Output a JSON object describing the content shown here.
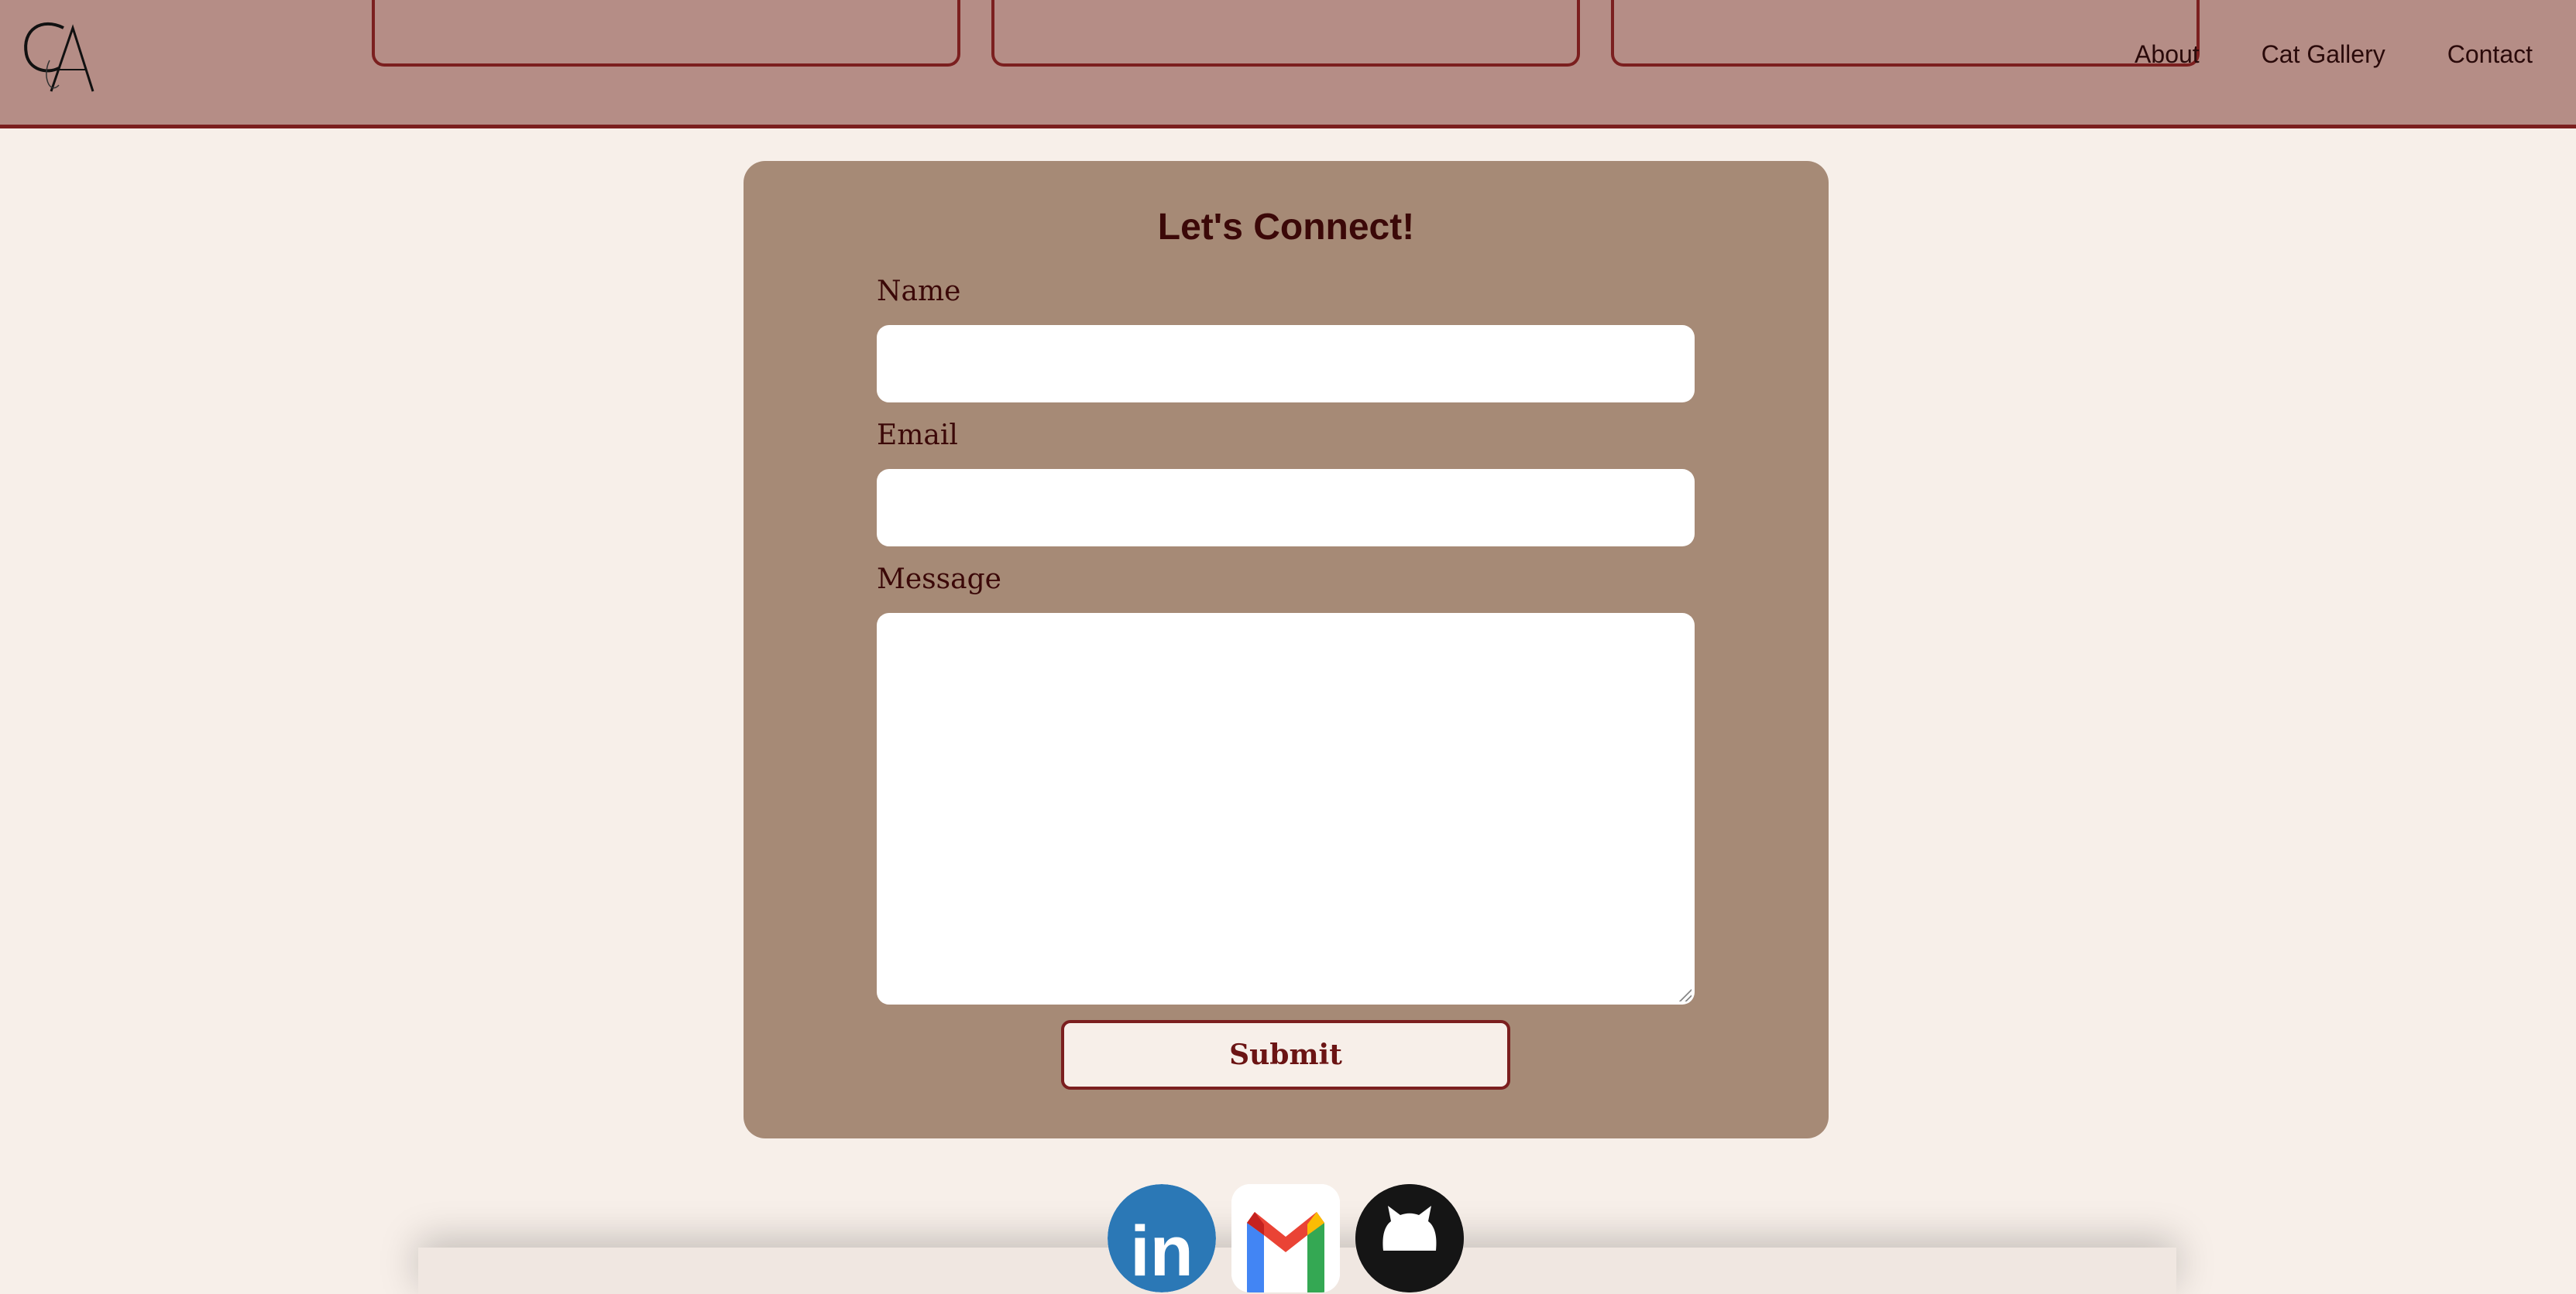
{
  "header": {
    "logo_text": "CA",
    "nav": [
      {
        "label": "About"
      },
      {
        "label": "Cat Gallery"
      },
      {
        "label": "Contact"
      }
    ]
  },
  "form": {
    "title": "Let's Connect!",
    "name_label": "Name",
    "email_label": "Email",
    "message_label": "Message",
    "name_value": "",
    "email_value": "",
    "message_value": "",
    "submit_label": "Submit"
  },
  "social": [
    {
      "icon": "linkedin-icon",
      "text": "in"
    },
    {
      "icon": "gmail-icon"
    },
    {
      "icon": "github-icon"
    }
  ],
  "colors": {
    "header_bg": "#b58d86",
    "accent": "#7b1f1f",
    "page_bg": "#f7efe9",
    "card_bg": "#a68a76"
  }
}
